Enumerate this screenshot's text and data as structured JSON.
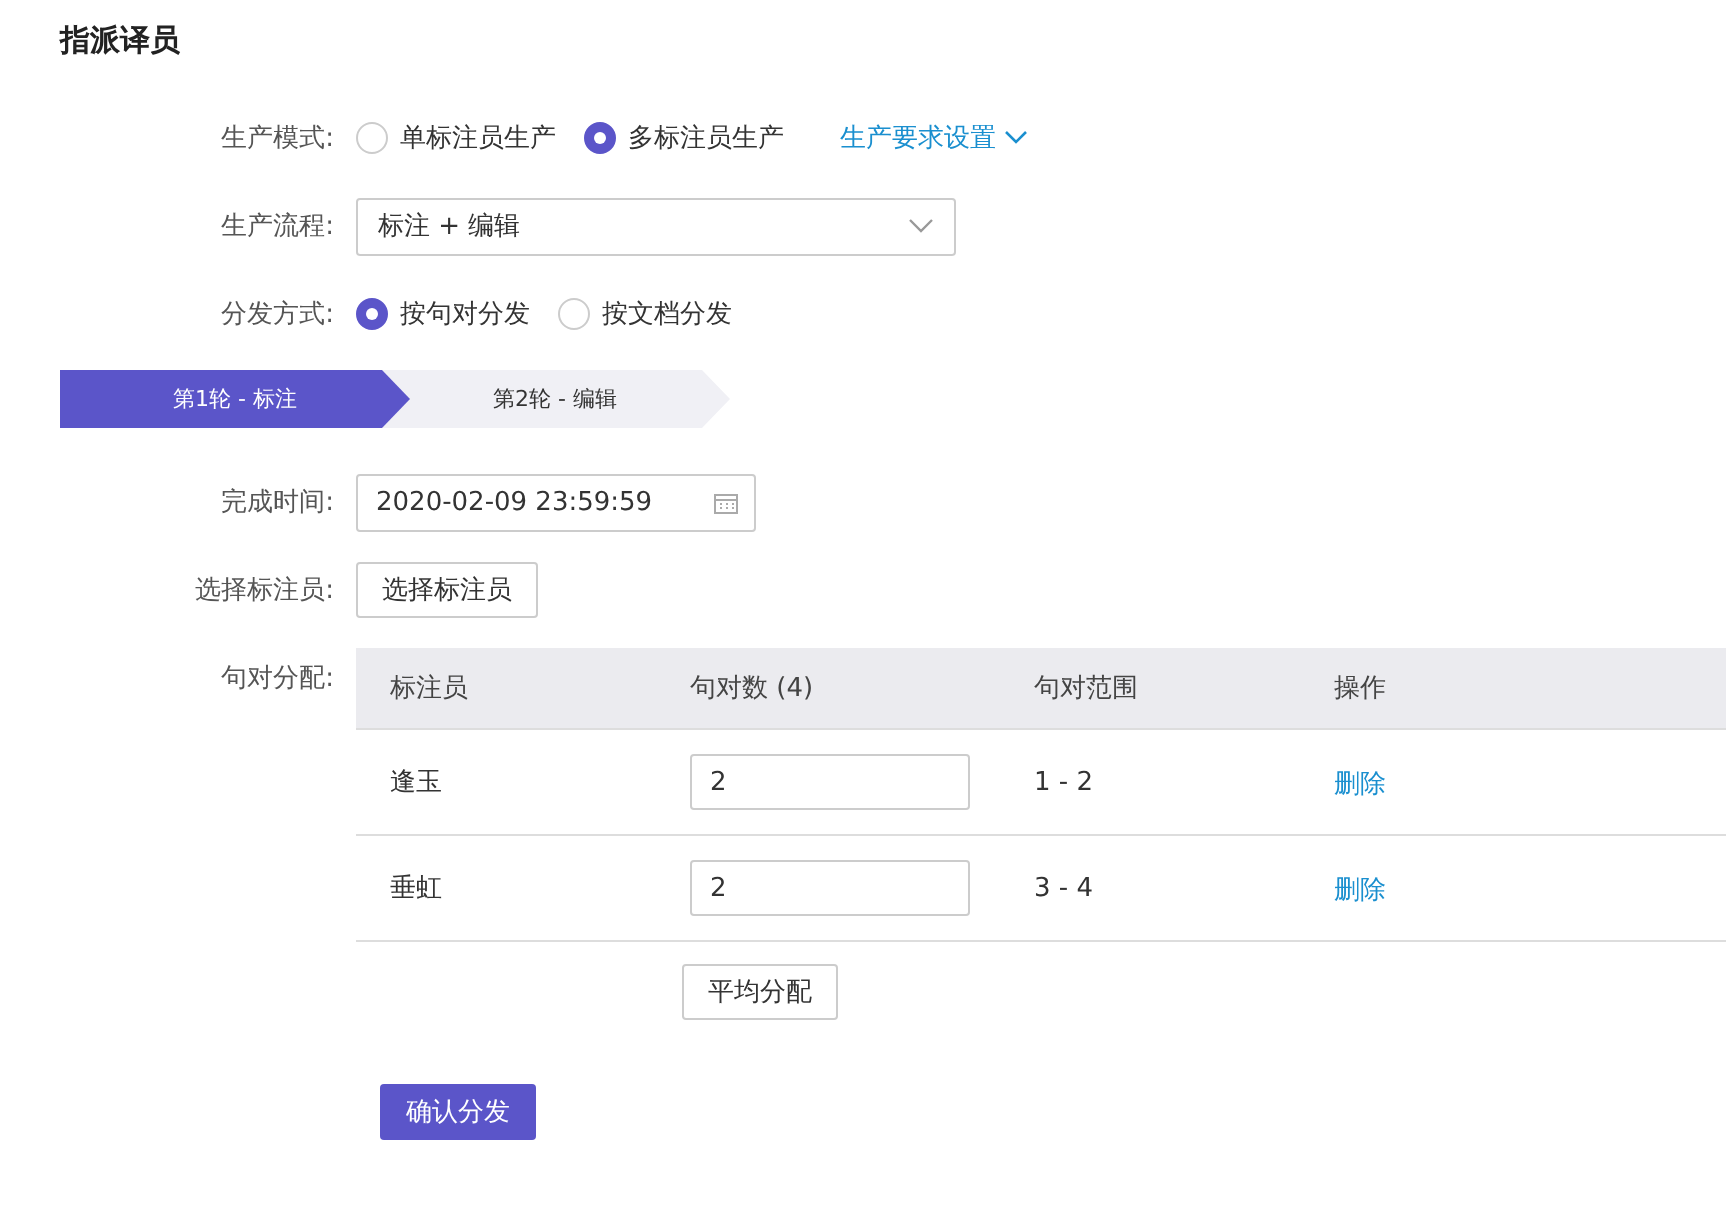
{
  "title": "指派译员",
  "mode": {
    "label": "生产模式:",
    "options": [
      {
        "label": "单标注员生产",
        "selected": false
      },
      {
        "label": "多标注员生产",
        "selected": true
      }
    ],
    "settings_link": "生产要求设置"
  },
  "flow": {
    "label": "生产流程:",
    "value": "标注 + 编辑"
  },
  "distribution": {
    "label": "分发方式:",
    "options": [
      {
        "label": "按句对分发",
        "selected": true
      },
      {
        "label": "按文档分发",
        "selected": false
      }
    ]
  },
  "steps": [
    {
      "label": "第1轮 - 标注",
      "selected": true
    },
    {
      "label": "第2轮 - 编辑",
      "selected": false
    }
  ],
  "deadline": {
    "label": "完成时间:",
    "value": "2020-02-09 23:59:59"
  },
  "annotators": {
    "label": "选择标注员:",
    "button": "选择标注员"
  },
  "allocation": {
    "label": "句对分配:",
    "columns": [
      "标注员",
      "句对数 (4)",
      "句对范围",
      "操作"
    ],
    "rows": [
      {
        "name": "逢玉",
        "count": "2",
        "range": "1 - 2",
        "action": "删除"
      },
      {
        "name": "垂虹",
        "count": "2",
        "range": "3 - 4",
        "action": "删除"
      }
    ],
    "average_button": "平均分配"
  },
  "confirm_button": "确认分发"
}
